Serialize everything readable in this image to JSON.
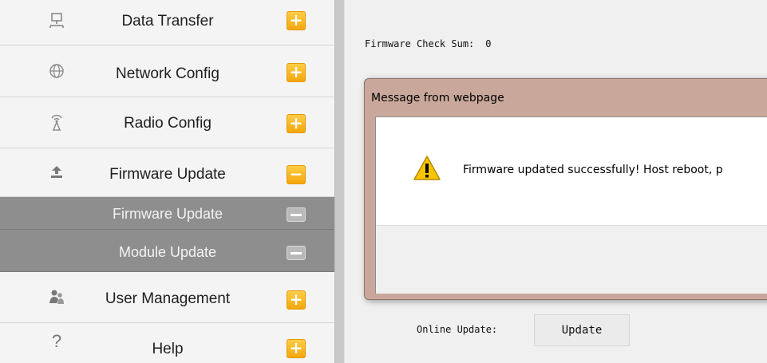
{
  "sidebar": {
    "items": [
      {
        "label": "Data Transfer",
        "icon": "network-computer-icon",
        "toggle": "+"
      },
      {
        "label": "Network Config",
        "icon": "globe-icon",
        "toggle": "+"
      },
      {
        "label": "Radio Config",
        "icon": "antenna-icon",
        "toggle": "+"
      },
      {
        "label": "Firmware Update",
        "icon": "upload-icon",
        "toggle": "−"
      },
      {
        "label": "User Management",
        "icon": "users-icon",
        "toggle": "+"
      },
      {
        "label": "Help",
        "icon": "question-icon",
        "toggle": "+"
      }
    ],
    "subitems": [
      {
        "label": "Firmware Update"
      },
      {
        "label": "Module Update"
      }
    ]
  },
  "main": {
    "checksum_label": "Firmware Check Sum:",
    "checksum_value": "0",
    "online_update_label": "Online Update:",
    "update_button": "Update"
  },
  "dialog": {
    "title": "Message from webpage",
    "message": "Firmware updated successfully! Host reboot, p"
  },
  "colors": {
    "accent": "#f5b021",
    "submenu_bg": "#8e8e8e",
    "dialog_frame": "#c9a89b"
  }
}
